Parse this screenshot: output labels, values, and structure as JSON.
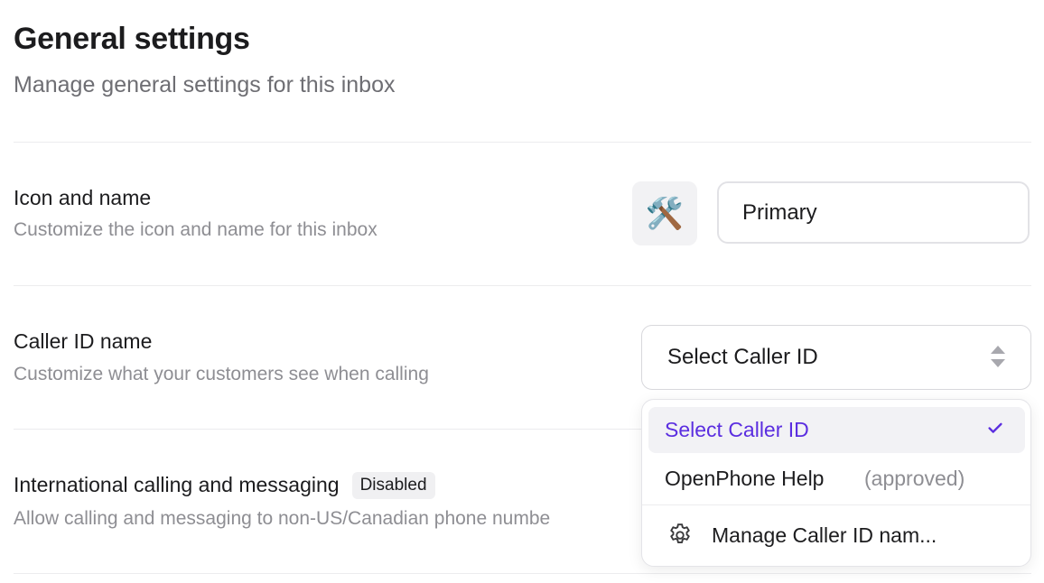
{
  "header": {
    "title": "General settings",
    "subtitle": "Manage general settings for this inbox"
  },
  "icon_and_name": {
    "title": "Icon and name",
    "description": "Customize the icon and name for this inbox",
    "icon_emoji": "🛠️",
    "icon_name": "hammer-and-wrench-icon",
    "name_value": "Primary"
  },
  "caller_id": {
    "title": "Caller ID name",
    "description": "Customize what your customers see when calling",
    "select_value": "Select Caller ID",
    "dropdown": {
      "options": [
        {
          "label": "Select Caller ID",
          "selected": true
        },
        {
          "label": "OpenPhone Help",
          "note": "(approved)",
          "selected": false
        }
      ],
      "manage_label": "Manage Caller ID nam..."
    }
  },
  "international": {
    "title": "International calling and messaging",
    "badge": "Disabled",
    "description": "Allow calling and messaging to non-US/Canadian phone numbe"
  },
  "colors": {
    "accent": "#5b2ee0",
    "muted_text": "#8e8e93"
  }
}
